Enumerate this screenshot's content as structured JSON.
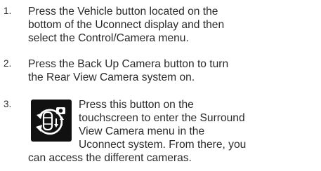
{
  "steps": [
    {
      "number": "1.",
      "lines": [
        "Press the Vehicle button located on the",
        "bottom of the Uconnect display and then",
        "select the Control/Camera menu."
      ]
    },
    {
      "number": "2.",
      "lines": [
        "Press the Back Up Camera button to turn",
        "the Rear View Camera system on."
      ]
    },
    {
      "number": "3.",
      "icon": "surround-view-camera-icon",
      "lines": [
        "Press this button on the",
        "touchscreen to enter the Surround",
        "View Camera menu in the",
        "Uconnect system. From there, you",
        "can access the different cameras."
      ]
    }
  ]
}
